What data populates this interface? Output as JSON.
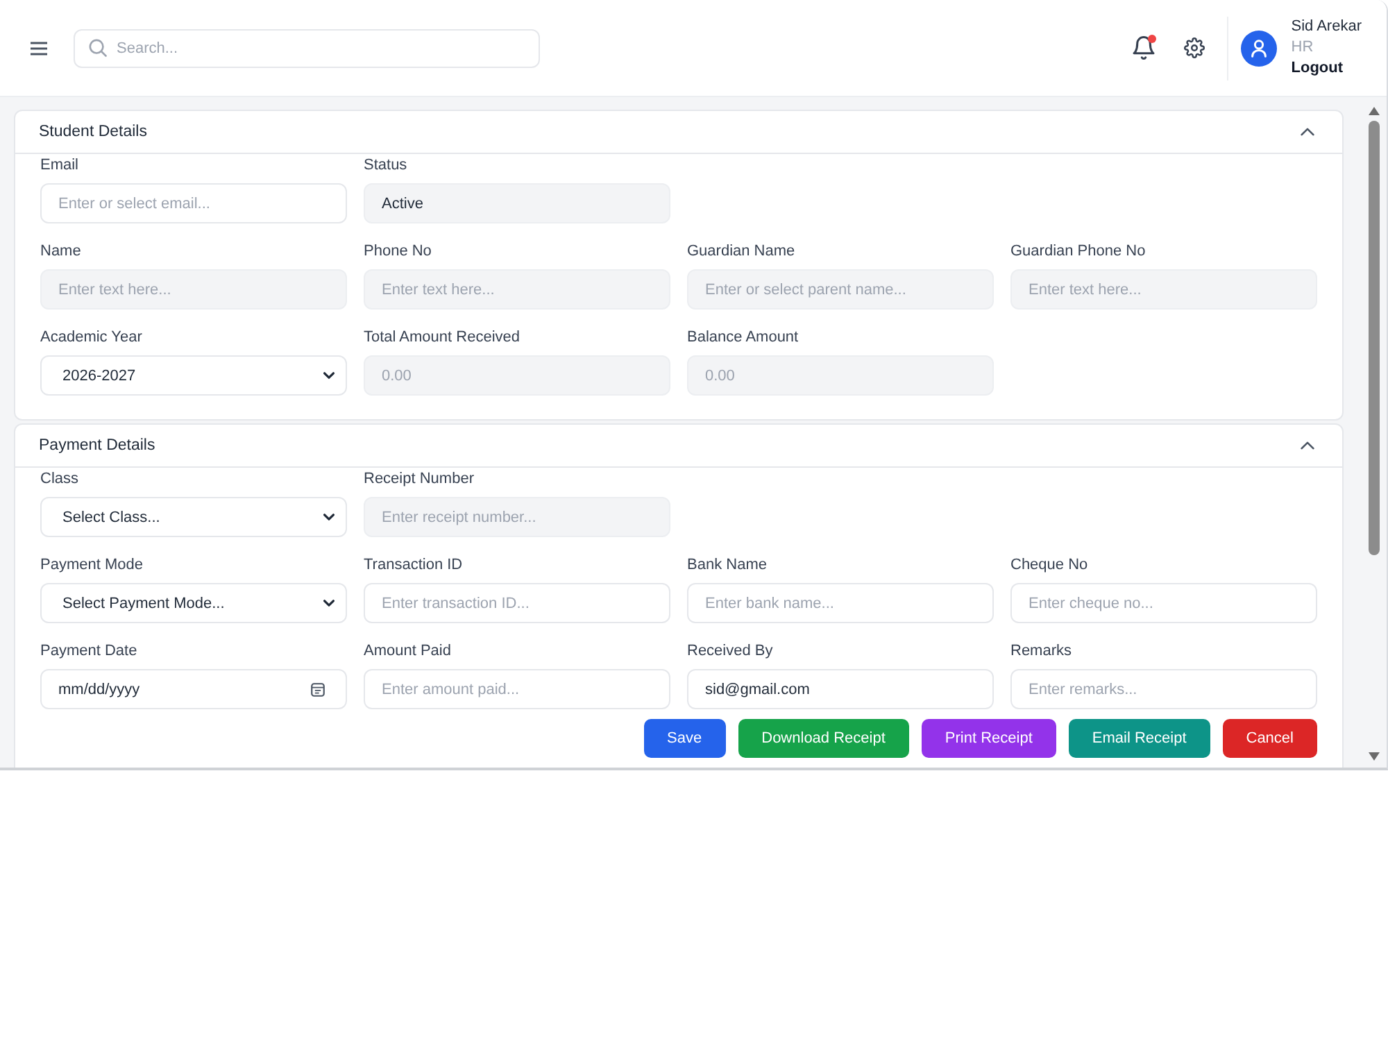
{
  "header": {
    "search": {
      "placeholder": "Search..."
    },
    "notifications": {
      "unread": true
    },
    "user": {
      "name": "Sid Arekar",
      "role": "HR",
      "logout": "Logout"
    }
  },
  "sections": [
    {
      "title": "Student Details",
      "expanded": true,
      "rows": [
        [
          {
            "label": "Email",
            "kind": "text",
            "placeholder": "Enter or select email...",
            "disabled": false
          },
          {
            "label": "Status",
            "kind": "text",
            "value": "Active",
            "disabled": true
          }
        ],
        [
          {
            "label": "Name",
            "kind": "text",
            "placeholder": "Enter text here...",
            "disabled": true
          },
          {
            "label": "Phone No",
            "kind": "text",
            "placeholder": "Enter text here...",
            "disabled": true
          },
          {
            "label": "Guardian Name",
            "kind": "text",
            "placeholder": "Enter or select parent name...",
            "disabled": true
          },
          {
            "label": "Guardian Phone No",
            "kind": "text",
            "placeholder": "Enter text here...",
            "disabled": true
          }
        ],
        [
          {
            "label": "Academic Year",
            "kind": "select",
            "value": "2026-2027",
            "disabled": false
          },
          {
            "label": "Total Amount Received",
            "kind": "text",
            "placeholder": "0.00",
            "disabled": true
          },
          {
            "label": "Balance Amount",
            "kind": "text",
            "placeholder": "0.00",
            "disabled": true
          }
        ]
      ]
    },
    {
      "title": "Payment Details",
      "expanded": true,
      "rows": [
        [
          {
            "label": "Class",
            "kind": "select",
            "value": "Select Class...",
            "disabled": false
          },
          {
            "label": "Receipt Number",
            "kind": "text",
            "placeholder": "Enter receipt number...",
            "disabled": true
          }
        ],
        [
          {
            "label": "Payment Mode",
            "kind": "select",
            "value": "Select Payment Mode...",
            "disabled": false
          },
          {
            "label": "Transaction ID",
            "kind": "text",
            "placeholder": "Enter transaction ID...",
            "disabled": false
          },
          {
            "label": "Bank Name",
            "kind": "text",
            "placeholder": "Enter bank name...",
            "disabled": false
          },
          {
            "label": "Cheque No",
            "kind": "text",
            "placeholder": "Enter cheque no...",
            "disabled": false
          }
        ],
        [
          {
            "label": "Payment Date",
            "kind": "date",
            "placeholder": "mm/dd/yyyy",
            "disabled": false
          },
          {
            "label": "Amount Paid",
            "kind": "text",
            "placeholder": "Enter amount paid...",
            "disabled": false
          },
          {
            "label": "Received By",
            "kind": "text",
            "value": "sid@gmail.com",
            "disabled": false
          },
          {
            "label": "Remarks",
            "kind": "text",
            "placeholder": "Enter remarks...",
            "disabled": false
          }
        ]
      ],
      "buttons": [
        {
          "label": "Save",
          "color": "#2563eb"
        },
        {
          "label": "Download Receipt",
          "color": "#16a34a"
        },
        {
          "label": "Print Receipt",
          "color": "#9333ea"
        },
        {
          "label": "Email Receipt",
          "color": "#0d9488"
        },
        {
          "label": "Cancel",
          "color": "#dc2626"
        }
      ]
    }
  ]
}
